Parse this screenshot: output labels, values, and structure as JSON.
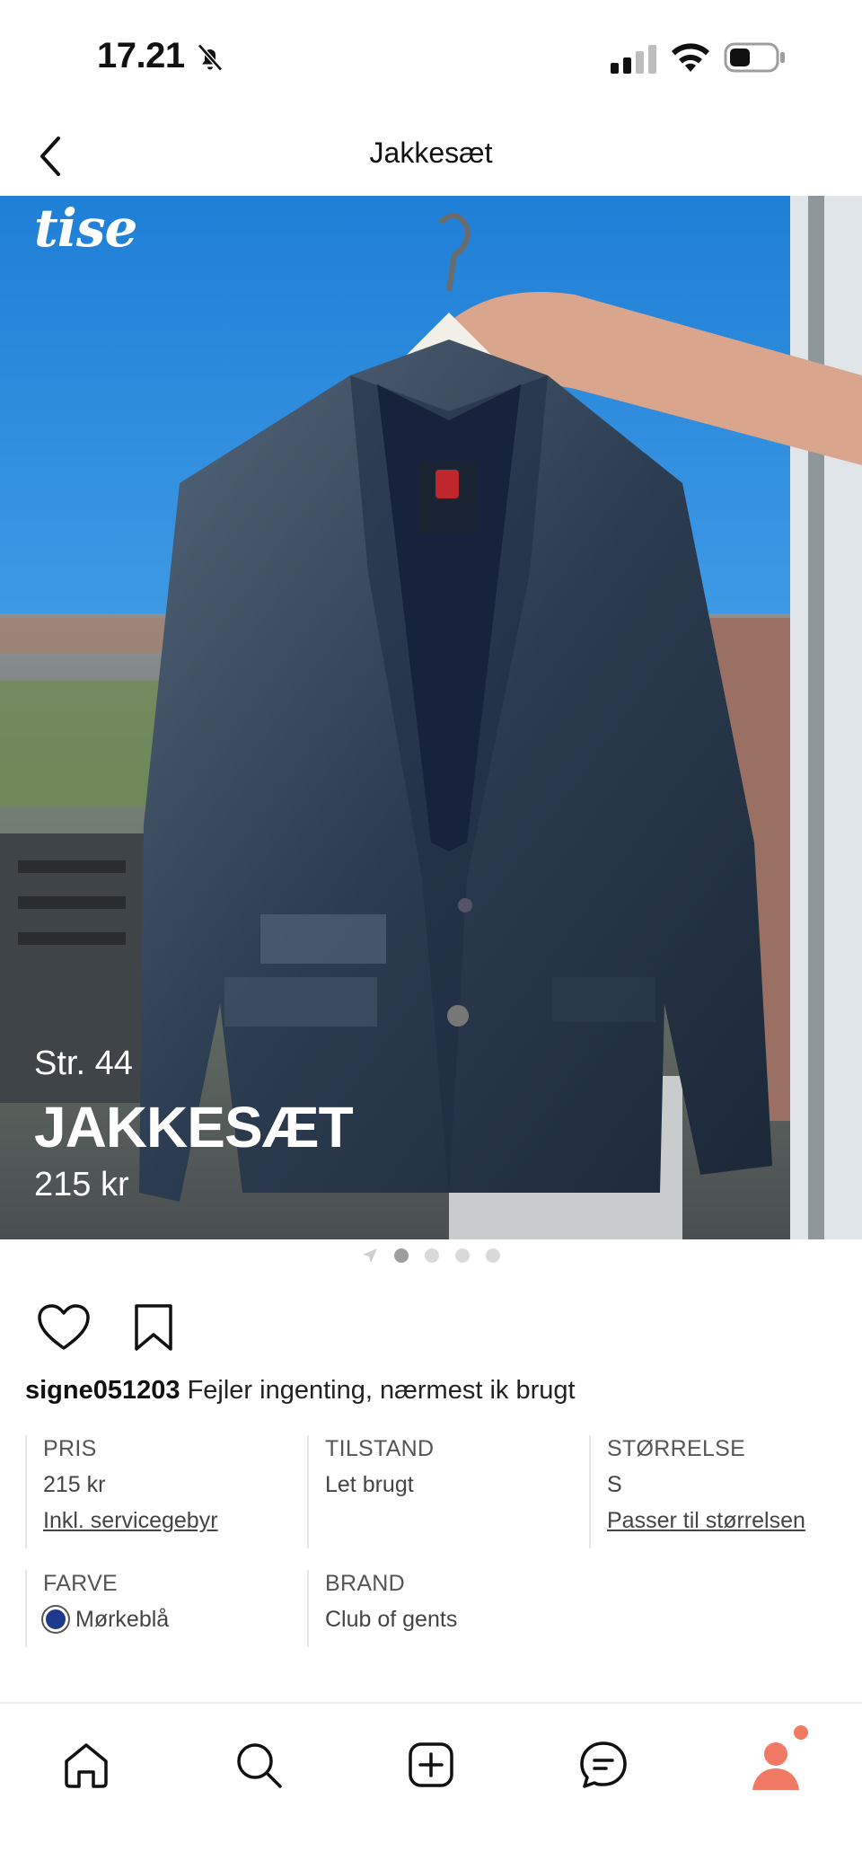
{
  "status_bar": {
    "time": "17.21",
    "icons": [
      "bell-off-icon",
      "signal-icon",
      "wifi-icon",
      "battery-icon"
    ]
  },
  "nav": {
    "title": "Jakkesæt",
    "back_icon": "chevron-left-icon"
  },
  "hero": {
    "watermark": "tise",
    "size": "Str. 44",
    "title": "JAKKESÆT",
    "price": "215 kr",
    "slides": 4,
    "active_slide": 0
  },
  "actions": {
    "like_icon": "heart-icon",
    "save_icon": "bookmark-icon"
  },
  "description": {
    "username": "signe051203",
    "text": "Fejler ingenting, nærmest ik brugt"
  },
  "details": {
    "price": {
      "label": "PRIS",
      "value": "215 kr",
      "link": "Inkl. servicegebyr"
    },
    "condition": {
      "label": "TILSTAND",
      "value": "Let brugt"
    },
    "size": {
      "label": "STØRRELSE",
      "value": "S",
      "link": "Passer til størrelsen"
    },
    "color": {
      "label": "FARVE",
      "value": "Mørkeblå",
      "swatch": "#1f3a8a"
    },
    "brand": {
      "label": "BRAND",
      "value": "Club of gents"
    }
  },
  "tabs": [
    {
      "icon": "home-icon"
    },
    {
      "icon": "search-icon"
    },
    {
      "icon": "add-icon"
    },
    {
      "icon": "chat-icon"
    },
    {
      "icon": "profile-icon",
      "accent": "#f07a63",
      "notification": true
    }
  ],
  "colors": {
    "accent": "#f07a63",
    "divider": "#e6e6e6"
  }
}
